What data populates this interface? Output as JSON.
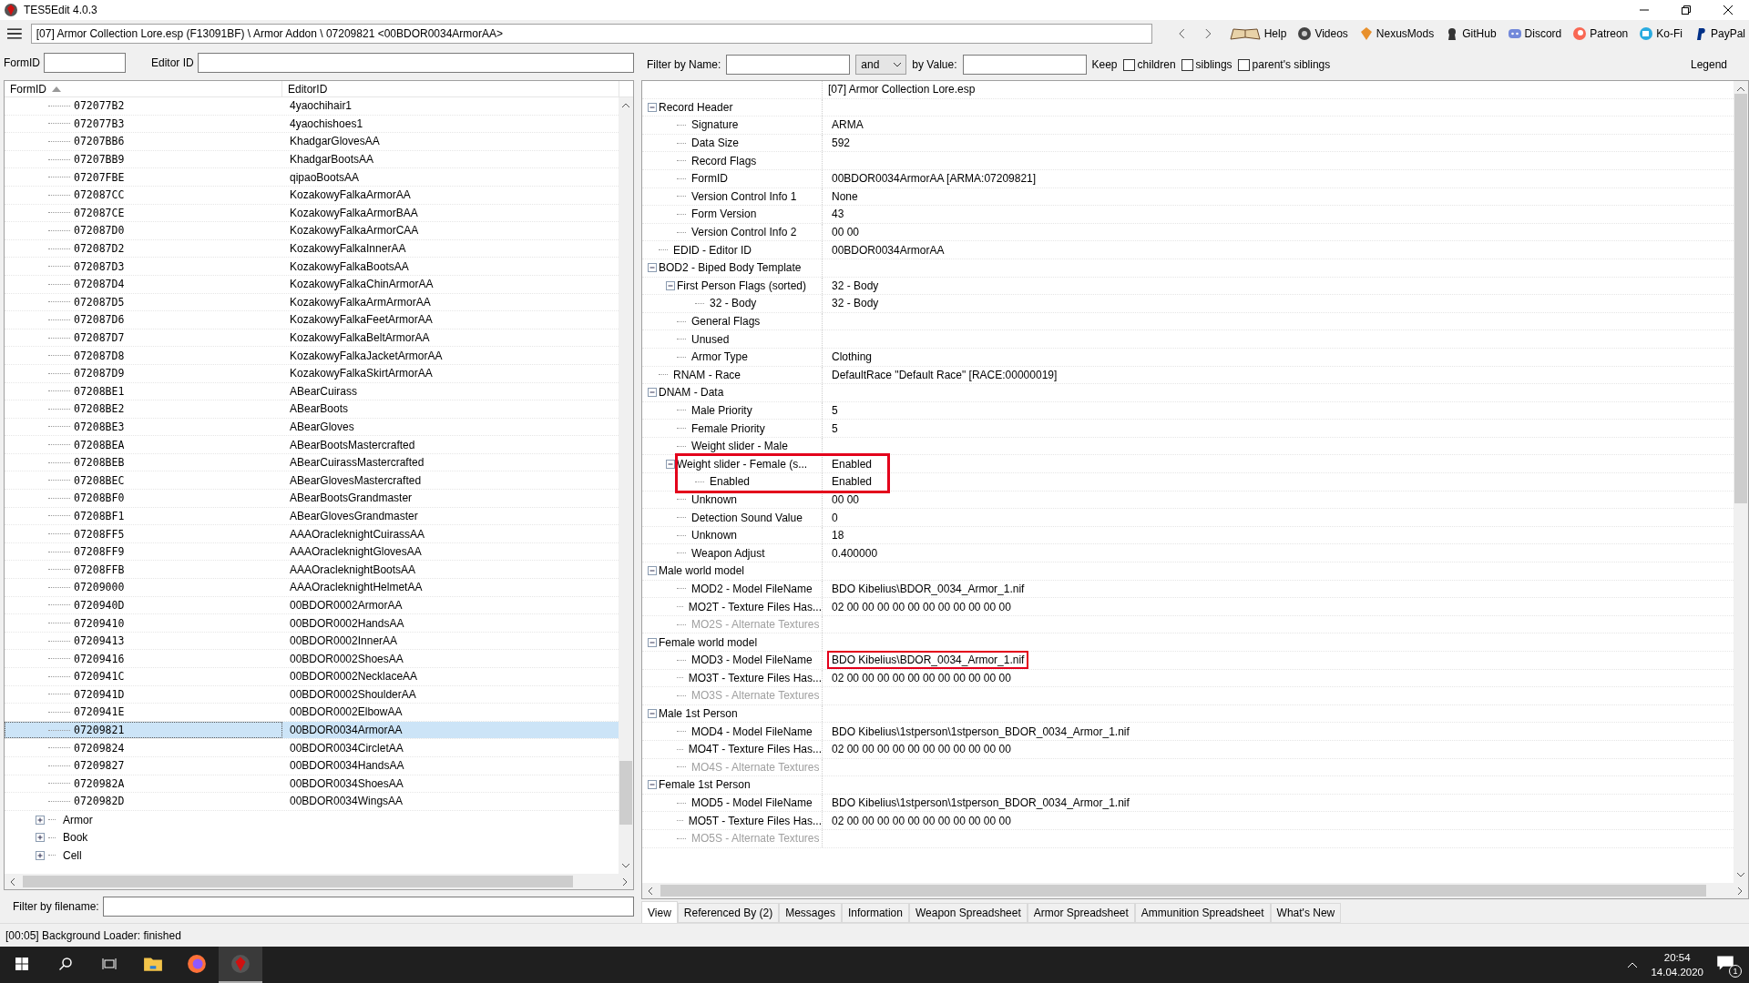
{
  "window": {
    "title": "TES5Edit 4.0.3"
  },
  "path": "[07] Armor Collection Lore.esp (F13091BF) \\ Armor Addon \\ 07209821 <00BDOR0034ArmorAA>",
  "links": [
    {
      "label": "Help",
      "kind": "book"
    },
    {
      "label": "Videos",
      "kind": "gp"
    },
    {
      "label": "NexusMods",
      "kind": "nexus"
    },
    {
      "label": "GitHub",
      "kind": "github"
    },
    {
      "label": "Discord",
      "kind": "discord"
    },
    {
      "label": "Patreon",
      "kind": "patreon"
    },
    {
      "label": "Ko-Fi",
      "kind": "kofi"
    },
    {
      "label": "PayPal",
      "kind": "paypal"
    }
  ],
  "left": {
    "formid_label": "FormID",
    "editorid_label": "Editor ID",
    "columns": [
      "FormID",
      "EditorID"
    ],
    "rows": [
      {
        "formid": "072077B2",
        "editor_id": "4yaochihair1",
        "selected": false
      },
      {
        "formid": "072077B3",
        "editor_id": "4yaochishoes1",
        "selected": false
      },
      {
        "formid": "07207BB6",
        "editor_id": "KhadgarGlovesAA",
        "selected": false
      },
      {
        "formid": "07207BB9",
        "editor_id": "KhadgarBootsAA",
        "selected": false
      },
      {
        "formid": "07207FBE",
        "editor_id": "qipaoBootsAA",
        "selected": false
      },
      {
        "formid": "072087CC",
        "editor_id": "KozakowyFalkaArmorAA",
        "selected": false
      },
      {
        "formid": "072087CE",
        "editor_id": "KozakowyFalkaArmorBAA",
        "selected": false
      },
      {
        "formid": "072087D0",
        "editor_id": "KozakowyFalkaArmorCAA",
        "selected": false
      },
      {
        "formid": "072087D2",
        "editor_id": "KozakowyFalkaInnerAA",
        "selected": false
      },
      {
        "formid": "072087D3",
        "editor_id": "KozakowyFalkaBootsAA",
        "selected": false
      },
      {
        "formid": "072087D4",
        "editor_id": "KozakowyFalkaChinArmorAA",
        "selected": false
      },
      {
        "formid": "072087D5",
        "editor_id": "KozakowyFalkaArmArmorAA",
        "selected": false
      },
      {
        "formid": "072087D6",
        "editor_id": "KozakowyFalkaFeetArmorAA",
        "selected": false
      },
      {
        "formid": "072087D7",
        "editor_id": "KozakowyFalkaBeltArmorAA",
        "selected": false
      },
      {
        "formid": "072087D8",
        "editor_id": "KozakowyFalkaJacketArmorAA",
        "selected": false
      },
      {
        "formid": "072087D9",
        "editor_id": "KozakowyFalkaSkirtArmorAA",
        "selected": false
      },
      {
        "formid": "07208BE1",
        "editor_id": "ABearCuirass",
        "selected": false
      },
      {
        "formid": "07208BE2",
        "editor_id": "ABearBoots",
        "selected": false
      },
      {
        "formid": "07208BE3",
        "editor_id": "ABearGloves",
        "selected": false
      },
      {
        "formid": "07208BEA",
        "editor_id": "ABearBootsMastercrafted",
        "selected": false
      },
      {
        "formid": "07208BEB",
        "editor_id": "ABearCuirassMastercrafted",
        "selected": false
      },
      {
        "formid": "07208BEC",
        "editor_id": "ABearGlovesMastercrafted",
        "selected": false
      },
      {
        "formid": "07208BF0",
        "editor_id": "ABearBootsGrandmaster",
        "selected": false
      },
      {
        "formid": "07208BF1",
        "editor_id": "ABearGlovesGrandmaster",
        "selected": false
      },
      {
        "formid": "07208FF5",
        "editor_id": "AAAOracleknightCuirassAA",
        "selected": false
      },
      {
        "formid": "07208FF9",
        "editor_id": "AAAOracleknightGlovesAA",
        "selected": false
      },
      {
        "formid": "07208FFB",
        "editor_id": "AAAOracleknightBootsAA",
        "selected": false
      },
      {
        "formid": "07209000",
        "editor_id": "AAAOracleknightHelmetAA",
        "selected": false
      },
      {
        "formid": "0720940D",
        "editor_id": "00BDOR0002ArmorAA",
        "selected": false
      },
      {
        "formid": "07209410",
        "editor_id": "00BDOR0002HandsAA",
        "selected": false
      },
      {
        "formid": "07209413",
        "editor_id": "00BDOR0002InnerAA",
        "selected": false
      },
      {
        "formid": "07209416",
        "editor_id": "00BDOR0002ShoesAA",
        "selected": false
      },
      {
        "formid": "0720941C",
        "editor_id": "00BDOR0002NecklaceAA",
        "selected": false
      },
      {
        "formid": "0720941D",
        "editor_id": "00BDOR0002ShoulderAA",
        "selected": false
      },
      {
        "formid": "0720941E",
        "editor_id": "00BDOR0002ElbowAA",
        "selected": false
      },
      {
        "formid": "07209821",
        "editor_id": "00BDOR0034ArmorAA",
        "selected": true
      },
      {
        "formid": "07209824",
        "editor_id": "00BDOR0034CircletAA",
        "selected": false
      },
      {
        "formid": "07209827",
        "editor_id": "00BDOR0034HandsAA",
        "selected": false
      },
      {
        "formid": "0720982A",
        "editor_id": "00BDOR0034ShoesAA",
        "selected": false
      },
      {
        "formid": "0720982D",
        "editor_id": "00BDOR0034WingsAA",
        "selected": false
      }
    ],
    "groups": [
      {
        "label": "Armor",
        "expanded": false
      },
      {
        "label": "Book",
        "expanded": false
      },
      {
        "label": "Cell",
        "expanded": false
      }
    ],
    "filename_label": "Filter by filename:"
  },
  "filter": {
    "name_label": "Filter by Name:",
    "operator": "and",
    "value_label": "by Value:",
    "keep_label": "Keep",
    "keep_options": [
      {
        "label": "children",
        "checked": false
      },
      {
        "label": "siblings",
        "checked": false
      },
      {
        "label": "parent's siblings",
        "checked": false
      }
    ],
    "legend": "Legend"
  },
  "record": {
    "file": "[07] Armor Collection Lore.esp",
    "items": [
      {
        "name": "Record Header",
        "expanded": true,
        "children": [
          {
            "name": "Signature",
            "value": "ARMA"
          },
          {
            "name": "Data Size",
            "value": "592"
          },
          {
            "name": "Record Flags"
          },
          {
            "name": "FormID",
            "value": "00BDOR0034ArmorAA [ARMA:07209821]"
          },
          {
            "name": "Version Control Info 1",
            "value": "None"
          },
          {
            "name": "Form Version",
            "value": "43"
          },
          {
            "name": "Version Control Info 2",
            "value": "00 00"
          }
        ]
      },
      {
        "name": "EDID - Editor ID",
        "value": "00BDOR0034ArmorAA"
      },
      {
        "name": "BOD2 - Biped Body Template",
        "expanded": true,
        "children": [
          {
            "name": "First Person Flags (sorted)",
            "value": "32 - Body",
            "expanded": true,
            "children": [
              {
                "name": "32 - Body",
                "value": "32 - Body"
              }
            ]
          },
          {
            "name": "General Flags"
          },
          {
            "name": "Unused"
          },
          {
            "name": "Armor Type",
            "value": "Clothing"
          }
        ]
      },
      {
        "name": "RNAM - Race",
        "value": "DefaultRace \"Default Race\" [RACE:00000019]"
      },
      {
        "name": "DNAM - Data",
        "expanded": true,
        "children": [
          {
            "name": "Male Priority",
            "value": "5"
          },
          {
            "name": "Female Priority",
            "value": "5"
          },
          {
            "name": "Weight slider - Male"
          },
          {
            "name": "Weight slider - Female (s...",
            "value": "Enabled",
            "expanded": true,
            "boxed": true,
            "children": [
              {
                "name": "Enabled",
                "value": "Enabled"
              }
            ]
          },
          {
            "name": "Unknown",
            "value": "00 00"
          },
          {
            "name": "Detection Sound Value",
            "value": "0"
          },
          {
            "name": "Unknown",
            "value": "18"
          },
          {
            "name": "Weapon Adjust",
            "value": "0.400000"
          }
        ]
      },
      {
        "name": "Male world model",
        "expanded": true,
        "children": [
          {
            "name": "MOD2 - Model FileName",
            "value": "BDO Kibelius\\BDOR_0034_Armor_1.nif"
          },
          {
            "name": "MO2T - Texture Files Has...",
            "value": "02 00 00 00 00 00 00 00 00 00 00 00"
          },
          {
            "name": "MO2S - Alternate Textures",
            "disabled": true
          }
        ]
      },
      {
        "name": "Female world model",
        "expanded": true,
        "children": [
          {
            "name": "MOD3 - Model FileName",
            "value": "BDO Kibelius\\BDOR_0034_Armor_1.nif",
            "value_boxed": true
          },
          {
            "name": "MO3T - Texture Files Has...",
            "value": "02 00 00 00 00 00 00 00 00 00 00 00"
          },
          {
            "name": "MO3S - Alternate Textures",
            "disabled": true
          }
        ]
      },
      {
        "name": "Male 1st Person",
        "expanded": true,
        "children": [
          {
            "name": "MOD4 - Model FileName",
            "value": "BDO Kibelius\\1stperson\\1stperson_BDOR_0034_Armor_1.nif"
          },
          {
            "name": "MO4T - Texture Files Has...",
            "value": "02 00 00 00 00 00 00 00 00 00 00 00"
          },
          {
            "name": "MO4S - Alternate Textures",
            "disabled": true
          }
        ]
      },
      {
        "name": "Female 1st Person",
        "expanded": true,
        "children": [
          {
            "name": "MOD5 - Model FileName",
            "value": "BDO Kibelius\\1stperson\\1stperson_BDOR_0034_Armor_1.nif"
          },
          {
            "name": "MO5T - Texture Files Has...",
            "value": "02 00 00 00 00 00 00 00 00 00 00 00"
          },
          {
            "name": "MO5S - Alternate Textures",
            "disabled": true
          }
        ]
      }
    ]
  },
  "tabs": [
    {
      "label": "View",
      "selected": true
    },
    {
      "label": "Referenced By (2)",
      "selected": false
    },
    {
      "label": "Messages",
      "selected": false
    },
    {
      "label": "Information",
      "selected": false
    },
    {
      "label": "Weapon Spreadsheet",
      "selected": false
    },
    {
      "label": "Armor Spreadsheet",
      "selected": false
    },
    {
      "label": "Ammunition Spreadsheet",
      "selected": false
    },
    {
      "label": "What's New",
      "selected": false
    }
  ],
  "status_bar": "[00:05] Background Loader: finished",
  "taskbar": {
    "apps": [
      {
        "kind": "start"
      },
      {
        "kind": "search"
      },
      {
        "kind": "taskview"
      },
      {
        "kind": "folder"
      },
      {
        "kind": "firefox",
        "selected": false
      },
      {
        "kind": "tes5edit",
        "selected": true
      }
    ],
    "time": "20:54",
    "date": "14.04.2020",
    "notifications": "1"
  }
}
